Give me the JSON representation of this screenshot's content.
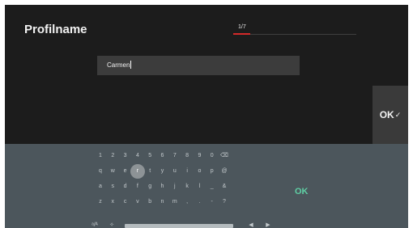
{
  "header": {
    "title": "Profilname",
    "step": "1/7",
    "progress": 0.14
  },
  "name_field": {
    "value": "Carmen"
  },
  "side_button": {
    "label": "OK",
    "check": "✓"
  },
  "keyboard": {
    "rows": [
      [
        "1",
        "2",
        "3",
        "4",
        "5",
        "6",
        "7",
        "8",
        "9",
        "0",
        "⌫"
      ],
      [
        "q",
        "w",
        "e",
        "r",
        "t",
        "y",
        "u",
        "i",
        "o",
        "p",
        "@"
      ],
      [
        "a",
        "s",
        "d",
        "f",
        "g",
        "h",
        "j",
        "k",
        "l",
        "_",
        "&"
      ],
      [
        "z",
        "x",
        "c",
        "v",
        "b",
        "n",
        "m",
        ",",
        ".",
        "-",
        "?"
      ]
    ],
    "focused_key": "r",
    "bottom": {
      "shift_label": "ᵃ/ᴬ",
      "symbol_label": "✧",
      "left_arrow": "◀",
      "right_arrow": "▶"
    },
    "ok_label": "OK"
  },
  "colors": {
    "screen_bg": "#1c1c1c",
    "keyboard_bg": "#4c565c",
    "progress_accent": "#d42a2a",
    "ok_accent": "#5fcfa4"
  }
}
